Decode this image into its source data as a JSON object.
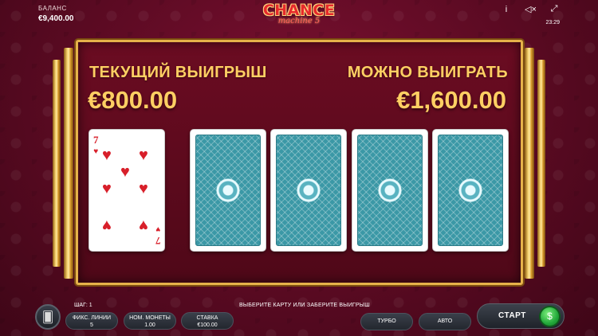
{
  "balance": {
    "label": "БАЛАНС",
    "value": "€9,400.00"
  },
  "logo": {
    "main": "CHANCE",
    "sub": "machine 5"
  },
  "top_icons": [
    "info-icon",
    "sound-mute-icon",
    "fullscreen-icon"
  ],
  "top_icon_glyphs": {
    "info": "i",
    "sound": "◁×",
    "fullscreen": "⤢"
  },
  "clock": "23:29",
  "current_win": {
    "title": "ТЕКУЩИЙ ВЫИГРЫШ",
    "amount": "€800.00"
  },
  "possible_win": {
    "title": "МОЖНО ВЫИГРАТЬ",
    "amount": "€1,600.00"
  },
  "dealer_card": {
    "rank": "7",
    "suit": "hearts",
    "color": "#d81f2a"
  },
  "hidden_cards": 4,
  "status": {
    "step": "ШАГ: 1",
    "message": "ВЫБЕРИТЕ КАРТУ ИЛИ ЗАБЕРИТЕ ВЫИГРЫШ"
  },
  "controls": {
    "lines": {
      "label": "ФИКС. ЛИНИИ",
      "value": "5"
    },
    "coin": {
      "label": "НОМ. МОНЕТЫ",
      "value": "1.00"
    },
    "stake": {
      "label": "СТАВКА",
      "value": "€100.00"
    },
    "turbo": "ТУРБО",
    "auto": "АВТО",
    "start": "СТАРТ"
  },
  "colors": {
    "gold": "#ffcf63",
    "card_back": "#3b98a6",
    "start_green": "#22a83a"
  }
}
